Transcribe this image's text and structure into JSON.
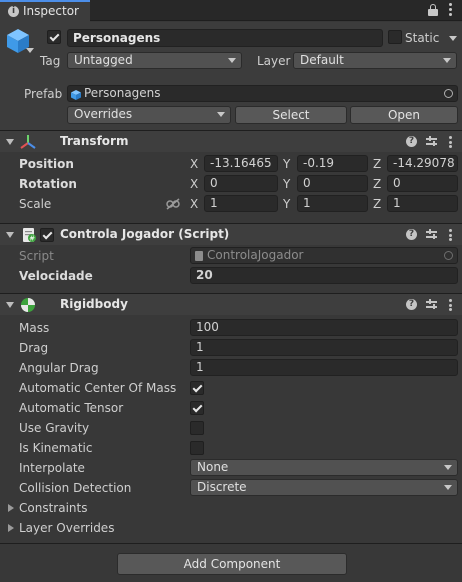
{
  "tab": {
    "label": "Inspector"
  },
  "header": {
    "active": true,
    "object_name": "Personagens",
    "static_label": "Static",
    "static_checked": false,
    "tag_label": "Tag",
    "tag_value": "Untagged",
    "layer_label": "Layer",
    "layer_value": "Default"
  },
  "prefab": {
    "label": "Prefab",
    "value": "Personagens",
    "overrides_label": "Overrides",
    "select_label": "Select",
    "open_label": "Open"
  },
  "transform": {
    "title": "Transform",
    "position": {
      "label": "Position",
      "x": "-13.16465",
      "y": "-0.19",
      "z": "-14.29078"
    },
    "rotation": {
      "label": "Rotation",
      "x": "0",
      "y": "0",
      "z": "0"
    },
    "scale": {
      "label": "Scale",
      "x": "1",
      "y": "1",
      "z": "1"
    },
    "axes": {
      "x": "X",
      "y": "Y",
      "z": "Z"
    }
  },
  "script_component": {
    "title": "Controla Jogador (Script)",
    "enabled": true,
    "script_label": "Script",
    "script_value": "ControlaJogador",
    "velocidade_label": "Velocidade",
    "velocidade_value": "20"
  },
  "rigidbody": {
    "title": "Rigidbody",
    "mass_label": "Mass",
    "mass": "100",
    "drag_label": "Drag",
    "drag": "1",
    "angular_drag_label": "Angular Drag",
    "angular_drag": "1",
    "auto_com_label": "Automatic Center Of Mass",
    "auto_com": true,
    "auto_tensor_label": "Automatic Tensor",
    "auto_tensor": true,
    "use_gravity_label": "Use Gravity",
    "use_gravity": false,
    "is_kinematic_label": "Is Kinematic",
    "is_kinematic": false,
    "interpolate_label": "Interpolate",
    "interpolate": "None",
    "collision_label": "Collision Detection",
    "collision": "Discrete",
    "constraints_label": "Constraints",
    "layer_overrides_label": "Layer Overrides"
  },
  "add_component_label": "Add Component",
  "colors": {
    "panel": "#383838",
    "header": "#3e3e3e",
    "field": "#2a2a2a",
    "accent": "#4c8ee8"
  }
}
